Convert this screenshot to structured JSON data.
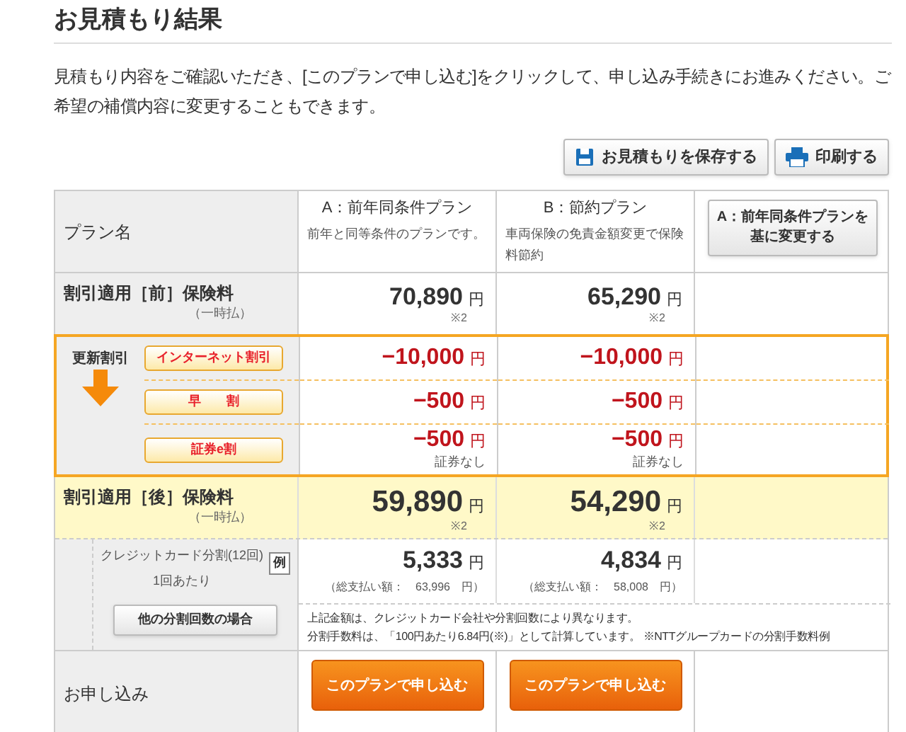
{
  "title": "お見積もり結果",
  "intro": "見積もり内容をご確認いただき、[このプランで申し込む]をクリックして、申し込み手続きにお進みください。ご希望の補償内容に変更することもできます。",
  "actions": [
    {
      "kind": "save",
      "label": "お見積もりを保存する"
    },
    {
      "kind": "print",
      "label": "印刷する"
    }
  ],
  "table": {
    "header_label": "プラン名",
    "plans": [
      {
        "name": "A：前年同条件プラン",
        "description": "前年と同等条件のプランです。",
        "price_before": {
          "value": "70,890",
          "yen": "円",
          "mark": "※2"
        },
        "price_after": {
          "value": "59,890",
          "yen": "円",
          "mark": "※2"
        },
        "installment": {
          "value": "5,333",
          "yen": "円"
        },
        "installment_total": "（総支払い額：　63,996　円）",
        "apply": "このプランで申し込む"
      },
      {
        "name": "B：節約プラン",
        "description": "車両保険の免責金額変更で保険料節約",
        "price_before": {
          "value": "65,290",
          "yen": "円",
          "mark": "※2"
        },
        "price_after": {
          "value": "54,290",
          "yen": "円",
          "mark": "※2"
        },
        "installment": {
          "value": "4,834",
          "yen": "円"
        },
        "installment_total": "（総支払い額：　58,008　円）",
        "apply": "このプランで申し込む"
      }
    ],
    "change_button": "A：前年同条件プランを基に変更する",
    "before_label": "割引適用［前］保険料",
    "after_label": "割引適用［後］保険料",
    "lump_sum": "（一時払）",
    "lump_sum_after": "（一時払）",
    "discount_title": "更新割引",
    "discounts": [
      {
        "label": "インターネット割引",
        "amounts": [
          {
            "value": "−10,000",
            "yen": "円"
          },
          {
            "value": "−10,000",
            "yen": "円"
          }
        ]
      },
      {
        "label": "早　　割",
        "amounts": [
          {
            "value": "−500",
            "yen": "円"
          },
          {
            "value": "−500",
            "yen": "円"
          }
        ]
      },
      {
        "label": "証券e割",
        "amounts": [
          {
            "value": "−500",
            "yen": "円",
            "note": "証券なし"
          },
          {
            "value": "−500",
            "yen": "円",
            "note": "証券なし"
          }
        ]
      }
    ],
    "installment_label": "クレジットカード分割(12回)",
    "installment_unit": "1回あたり",
    "example_badge": "例",
    "other_installments_button": "他の分割回数の場合",
    "installment_notes": [
      "上記金額は、クレジットカード会社や分割回数により異なります。",
      "分割手数料は、「100円あたり6.84円(※)」として計算しています。 ※NTTグループカードの分割手数料例"
    ],
    "apply_label": "お申し込み"
  }
}
